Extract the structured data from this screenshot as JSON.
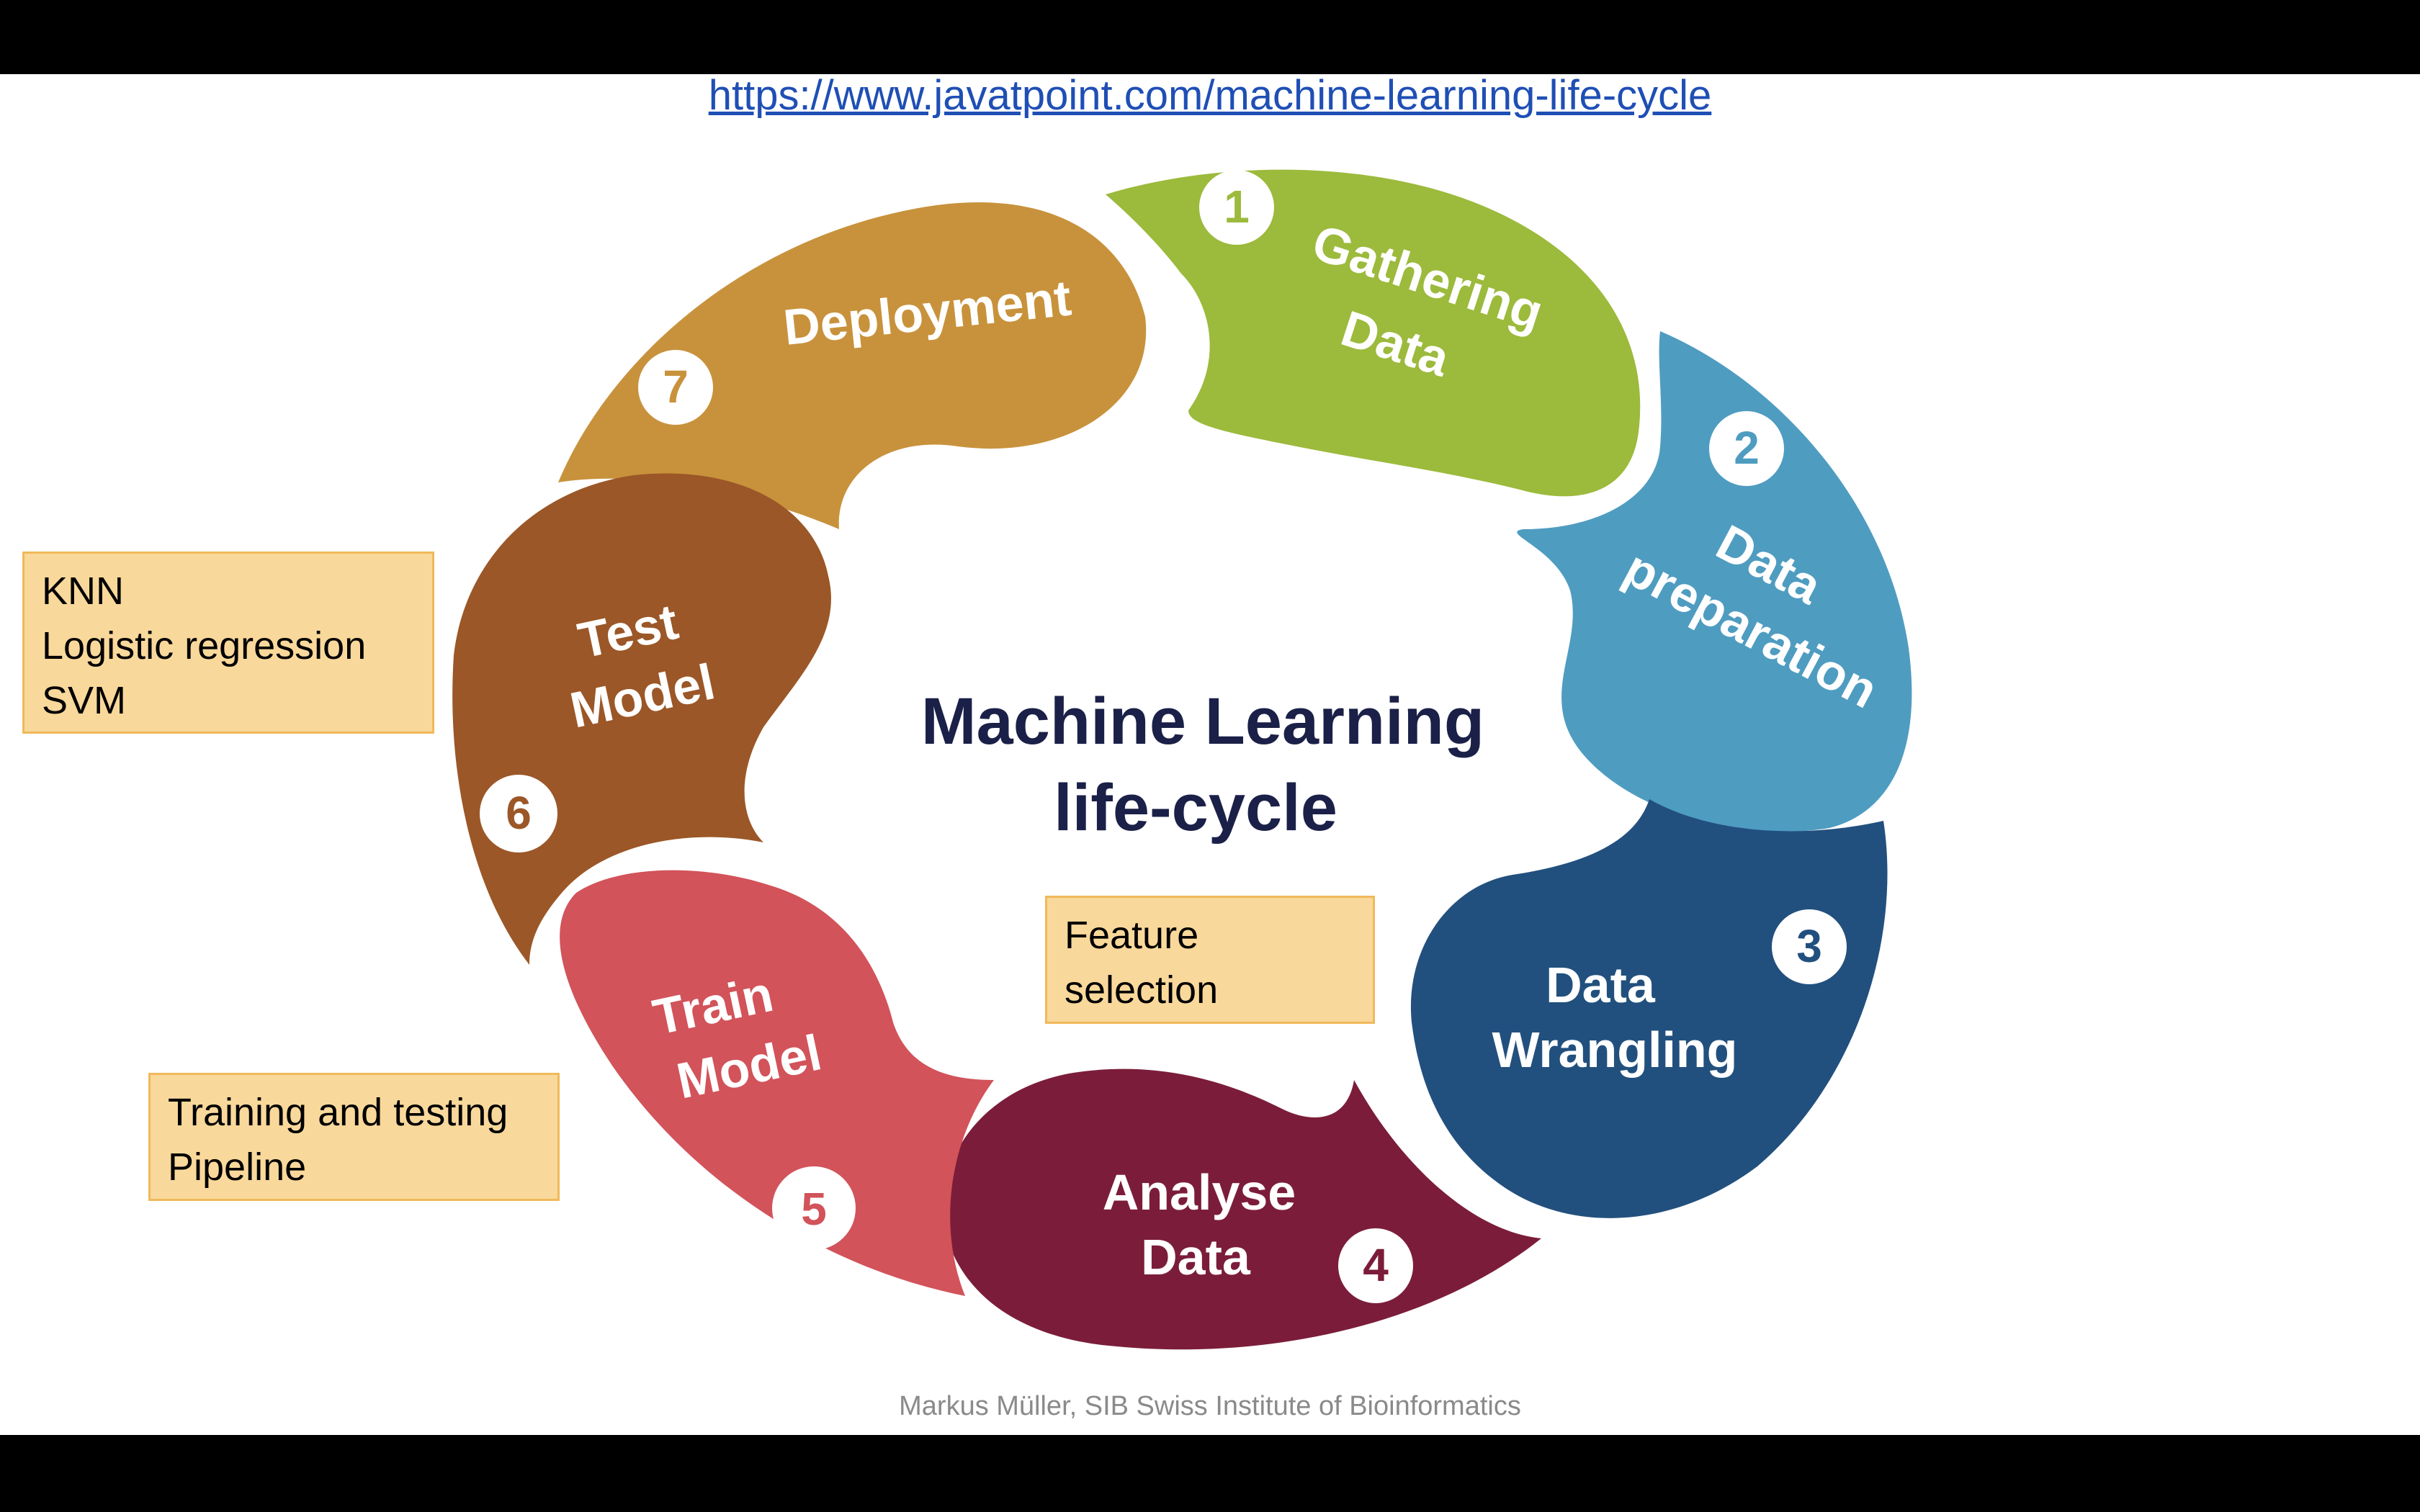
{
  "link": {
    "text": "https://www.javatpoint.com/machine-learning-life-cycle"
  },
  "center": {
    "line1": "Machine Learning",
    "line2": "life-cycle",
    "color": "#1b2048"
  },
  "segments": [
    {
      "number": "1",
      "label": [
        "Gathering",
        "Data"
      ],
      "color": "#9cba3c"
    },
    {
      "number": "2",
      "label": [
        "Data",
        "preparation"
      ],
      "color": "#4f9cc1"
    },
    {
      "number": "3",
      "label": [
        "Data",
        "Wrangling"
      ],
      "color": "#22507e"
    },
    {
      "number": "4",
      "label": [
        "Analyse",
        "Data"
      ],
      "color": "#7b1d3a"
    },
    {
      "number": "5",
      "label": [
        "Train",
        "Model"
      ],
      "color": "#d2535a"
    },
    {
      "number": "6",
      "label": [
        "Test",
        "Model"
      ],
      "color": "#9b5727"
    },
    {
      "number": "7",
      "label": [
        "Deployment"
      ],
      "color": "#c8923c"
    }
  ],
  "notes": [
    {
      "lines": [
        "KNN",
        "Logistic regression",
        "SVM"
      ]
    },
    {
      "lines": [
        "Feature",
        "selection"
      ]
    },
    {
      "lines": [
        "Training and testing",
        "Pipeline"
      ]
    }
  ],
  "footer": "Markus Müller, SIB Swiss Institute of Bioinformatics"
}
